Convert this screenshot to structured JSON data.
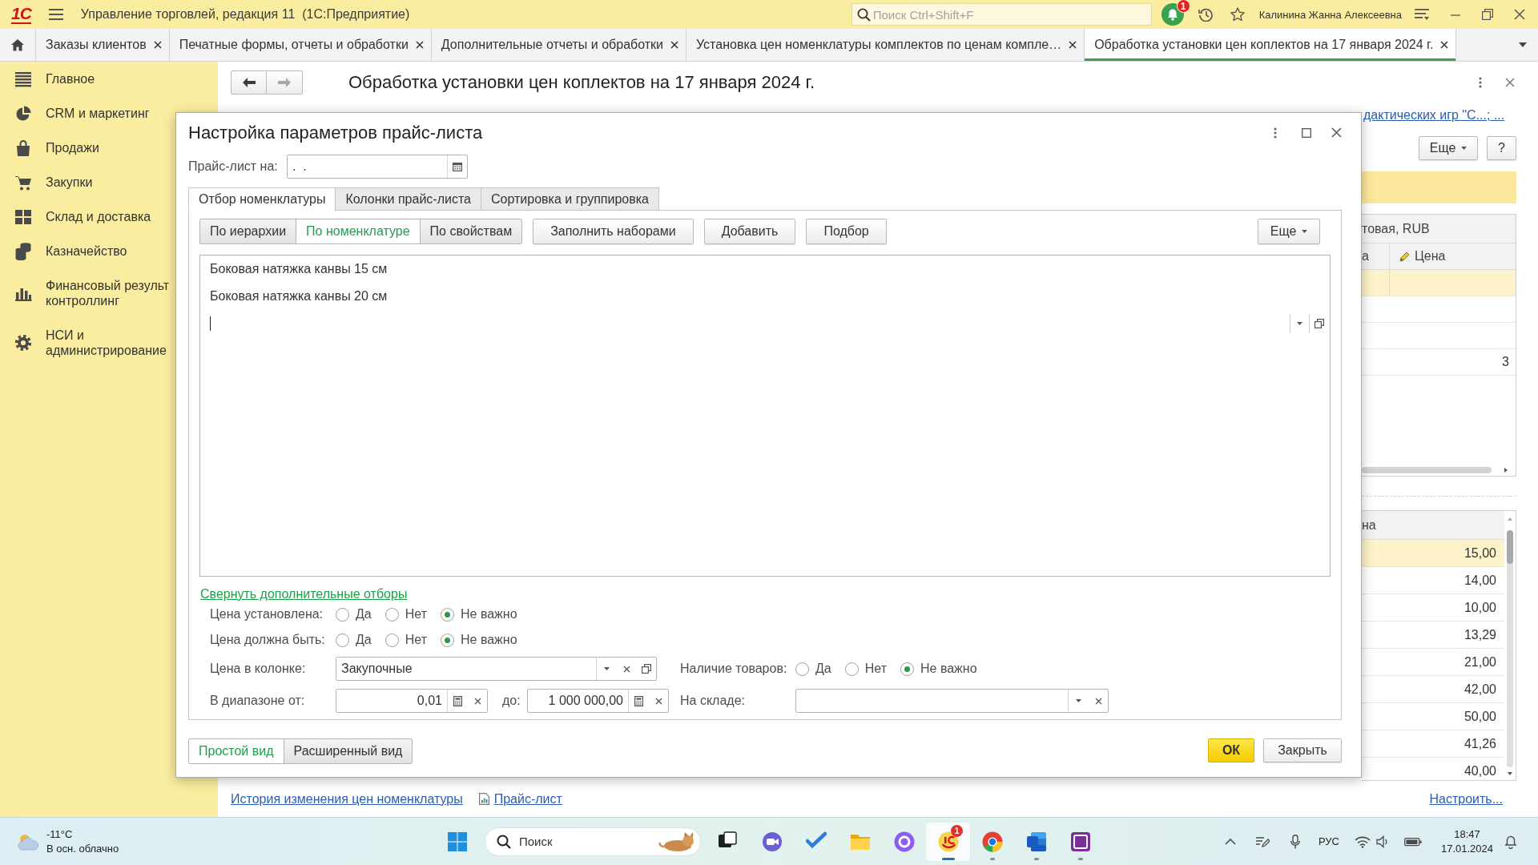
{
  "app_bar": {
    "logo": "1С",
    "title": "Управление торговлей, редакция 11  (1С:Предприятие)",
    "search": {
      "placeholder": "Поиск Ctrl+Shift+F"
    },
    "notification_badge": "1",
    "user": "Калинина Жанна Алексеевна"
  },
  "open_tabs": [
    {
      "label": "Заказы клиентов",
      "selected": false
    },
    {
      "label": "Печатные формы, отчеты и обработки",
      "selected": false
    },
    {
      "label": "Дополнительные отчеты и обработки",
      "selected": false
    },
    {
      "label": "Установка цен номенклатуры комплектов по ценам компле…",
      "selected": false
    },
    {
      "label": "Обработка установки цен коплектов на 17 января 2024 г.",
      "selected": true
    }
  ],
  "sidebar": {
    "items": [
      "Главное",
      "CRM и маркетинг",
      "Продажи",
      "Закупки",
      "Склад и доставка",
      "Казначейство",
      "Финансовый результ контроллинг",
      "НСИ и администрирование"
    ]
  },
  "form": {
    "title": "Обработка установки цен коплектов на 17 января 2024 г.",
    "link": "дактических игр \"С...; ...",
    "more_button": "Еще",
    "help_button": "?",
    "price_table": {
      "group_header": "товая, RUB",
      "columns": [
        {
          "label": "а",
          "kind": "plain"
        },
        {
          "label": "Цена",
          "kind": "editable"
        }
      ],
      "rows": [
        {
          "selected": true
        },
        {
          "selected": false
        },
        {
          "selected": false
        },
        {
          "selected": false,
          "price": "3"
        }
      ]
    },
    "history_table": {
      "header": "на",
      "rows": [
        {
          "selected": true,
          "price": "15,00"
        },
        {
          "selected": false,
          "price": "14,00"
        },
        {
          "selected": false,
          "price": "10,00"
        },
        {
          "selected": false,
          "price": "13,29"
        },
        {
          "selected": false,
          "price": "21,00"
        },
        {
          "selected": false,
          "price": "42,00"
        },
        {
          "selected": false,
          "price": "50,00"
        },
        {
          "selected": false,
          "price": "41,26"
        },
        {
          "selected": false,
          "price": "40,00"
        }
      ]
    },
    "footer_links": [
      {
        "label": "История изменения цен номенклатуры",
        "kind": "plain"
      },
      {
        "label": "Прайс-лист",
        "kind": "report"
      }
    ],
    "settings_link": "Настроить..."
  },
  "dialog": {
    "title": "Настройка параметров прайс-листа",
    "date_field": {
      "label": "Прайс-лист на:",
      "value": ".  ."
    },
    "tabs": [
      {
        "label": "Отбор номенклатуры",
        "selected": true
      },
      {
        "label": "Колонки прайс-листа",
        "selected": false
      },
      {
        "label": "Сортировка и группировка",
        "selected": false
      }
    ],
    "filter_modes": [
      {
        "label": "По иерархии",
        "selected": false
      },
      {
        "label": "По номенклатуре",
        "selected": true
      },
      {
        "label": "По свойствам",
        "selected": false
      }
    ],
    "buttons": [
      "Заполнить наборами",
      "Добавить",
      "Подбор"
    ],
    "more_button": "Еще",
    "items": [
      "Боковая натяжка канвы 15 см",
      "Боковая натяжка канвы 20 см"
    ],
    "new_item_editing": true,
    "collapse_link": "Свернуть дополнительные отборы",
    "radio_groups": [
      {
        "label": "Цена установлена:",
        "options": [
          {
            "label": "Да",
            "selected": false
          },
          {
            "label": "Нет",
            "selected": false
          },
          {
            "label": "Не важно",
            "selected": true
          }
        ]
      },
      {
        "label": "Цена должна быть:",
        "options": [
          {
            "label": "Да",
            "selected": false
          },
          {
            "label": "Нет",
            "selected": false
          },
          {
            "label": "Не важно",
            "selected": true
          }
        ]
      }
    ],
    "price_column": {
      "label": "Цена в колонке:",
      "value": "Закупочные"
    },
    "stock": {
      "label": "Наличие товаров:",
      "options": [
        {
          "label": "Да",
          "selected": false
        },
        {
          "label": "Нет",
          "selected": false
        },
        {
          "label": "Не важно",
          "selected": true
        }
      ]
    },
    "range": {
      "label": "В диапазоне от:",
      "from": "0,01",
      "to_label": "до:",
      "to": "1 000 000,00"
    },
    "warehouse": {
      "label": "На складе:"
    },
    "views": [
      {
        "label": "Простой вид",
        "selected": true
      },
      {
        "label": "Расширенный вид",
        "selected": false
      }
    ],
    "ok_button": "ОК",
    "close_button": "Закрыть"
  },
  "taskbar": {
    "weather": {
      "temperature": "-11°C",
      "condition": "В осн. облачно"
    },
    "search": {
      "placeholder": "Поиск"
    },
    "apps": [
      {
        "running": false,
        "selected": false
      },
      {
        "running": false,
        "selected": false
      },
      {
        "running": false,
        "selected": false
      },
      {
        "running": false,
        "selected": false
      },
      {
        "running": false,
        "selected": false
      },
      {
        "running": true,
        "selected": true,
        "badge": "1"
      },
      {
        "running": true,
        "selected": false
      },
      {
        "running": true,
        "selected": false
      },
      {
        "running": true,
        "selected": false
      }
    ],
    "language": "РУС",
    "time": "18:47",
    "date": "17.01.2024"
  }
}
